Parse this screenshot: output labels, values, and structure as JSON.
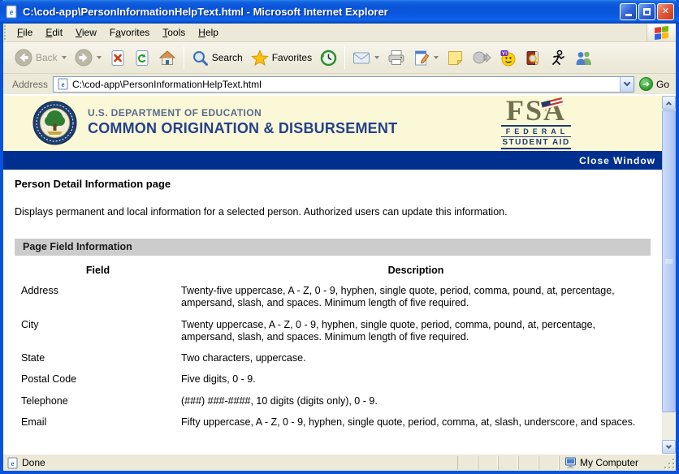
{
  "window": {
    "title": "C:\\cod-app\\PersonInformationHelpText.html - Microsoft Internet Explorer"
  },
  "menu": {
    "items": [
      {
        "label": "File",
        "underline": 0
      },
      {
        "label": "Edit",
        "underline": 0
      },
      {
        "label": "View",
        "underline": 0
      },
      {
        "label": "Favorites",
        "underline": 1
      },
      {
        "label": "Tools",
        "underline": 0
      },
      {
        "label": "Help",
        "underline": 0
      }
    ]
  },
  "toolbar": {
    "back_label": "Back",
    "search_label": "Search",
    "favorites_label": "Favorites"
  },
  "address_bar": {
    "label": "Address",
    "value": "C:\\cod-app\\PersonInformationHelpText.html",
    "go_label": "Go"
  },
  "banner": {
    "agency": "U.S. DEPARTMENT OF EDUCATION",
    "app_name": "COMMON ORIGINATION & DISBURSEMENT",
    "fsa": {
      "acronym": "FSA",
      "line1": "FEDERAL",
      "line2": "STUDENT AID"
    }
  },
  "nav_bar": {
    "close_window_label": "Close Window"
  },
  "page": {
    "title": "Person Detail Information page",
    "intro": "Displays permanent and local information for a selected person. Authorized users can update this information.",
    "section_title": "Page Field Information",
    "table": {
      "headers": {
        "field": "Field",
        "description": "Description"
      },
      "rows": [
        {
          "field": "Address",
          "description": "Twenty-five uppercase, A - Z, 0 - 9, hyphen, single quote, period, comma, pound, at, percentage, ampersand, slash, and spaces. Minimum length of five required."
        },
        {
          "field": "City",
          "description": "Twenty uppercase, A - Z, 0 - 9, hyphen, single quote, period, comma, pound, at, percentage, ampersand, slash, and spaces. Minimum length of five required."
        },
        {
          "field": "State",
          "description": "Two characters, uppercase."
        },
        {
          "field": "Postal Code",
          "description": "Five digits, 0 - 9."
        },
        {
          "field": "Telephone",
          "description": "(###) ###-####, 10 digits (digits only), 0 - 9."
        },
        {
          "field": "Email",
          "description": "Fifty uppercase, A - Z, 0 - 9, hyphen, single quote, period, comma, at, slash, underscore, and spaces."
        }
      ]
    }
  },
  "status_bar": {
    "status": "Done",
    "zone": "My Computer"
  },
  "colors": {
    "titlebar_blue": "#0A57DD",
    "banner_yellow": "#FBF8D8",
    "nav_navy": "#00308F",
    "section_gray": "#CCCCCC",
    "chrome_face": "#ECE9D8",
    "flag_red": "#e3392c",
    "flag_green": "#7fba00",
    "flag_blue": "#2f5fea",
    "flag_yellow": "#ffb900"
  }
}
